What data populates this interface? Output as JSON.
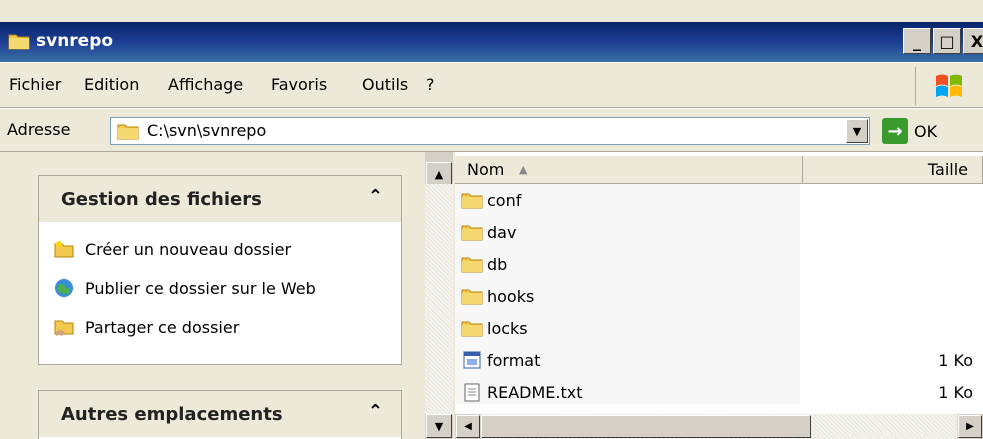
{
  "window": {
    "title": "svnrepo",
    "minimize": "_",
    "maximize": "□",
    "close": "X"
  },
  "menu": [
    {
      "label": "Fichier"
    },
    {
      "label": "Edition"
    },
    {
      "label": "Affichage"
    },
    {
      "label": "Favoris"
    },
    {
      "label": "Outils"
    },
    {
      "label": "?"
    }
  ],
  "address": {
    "label": "Adresse",
    "path": "C:\\svn\\svnrepo",
    "go_label": "OK"
  },
  "taskpane": {
    "file_tasks": {
      "title": "Gestion des fichiers",
      "items": [
        {
          "label": "Créer un nouveau dossier",
          "icon": "new-folder-icon"
        },
        {
          "label": "Publier ce dossier sur le Web",
          "icon": "publish-web-icon"
        },
        {
          "label": "Partager ce dossier",
          "icon": "share-folder-icon"
        }
      ]
    },
    "other_places": {
      "title": "Autres emplacements"
    }
  },
  "filelist": {
    "columns": {
      "name": "Nom",
      "size": "Taille"
    },
    "rows": [
      {
        "name": "conf",
        "type": "folder",
        "size": ""
      },
      {
        "name": "dav",
        "type": "folder",
        "size": ""
      },
      {
        "name": "db",
        "type": "folder",
        "size": ""
      },
      {
        "name": "hooks",
        "type": "folder",
        "size": ""
      },
      {
        "name": "locks",
        "type": "folder",
        "size": ""
      },
      {
        "name": "format",
        "type": "file",
        "size": "1 Ko"
      },
      {
        "name": "README.txt",
        "type": "text",
        "size": "1 Ko"
      }
    ]
  },
  "colors": {
    "titlebar": "#0a246a",
    "folder": "#f2c94c",
    "chrome": "#ece9d8"
  }
}
